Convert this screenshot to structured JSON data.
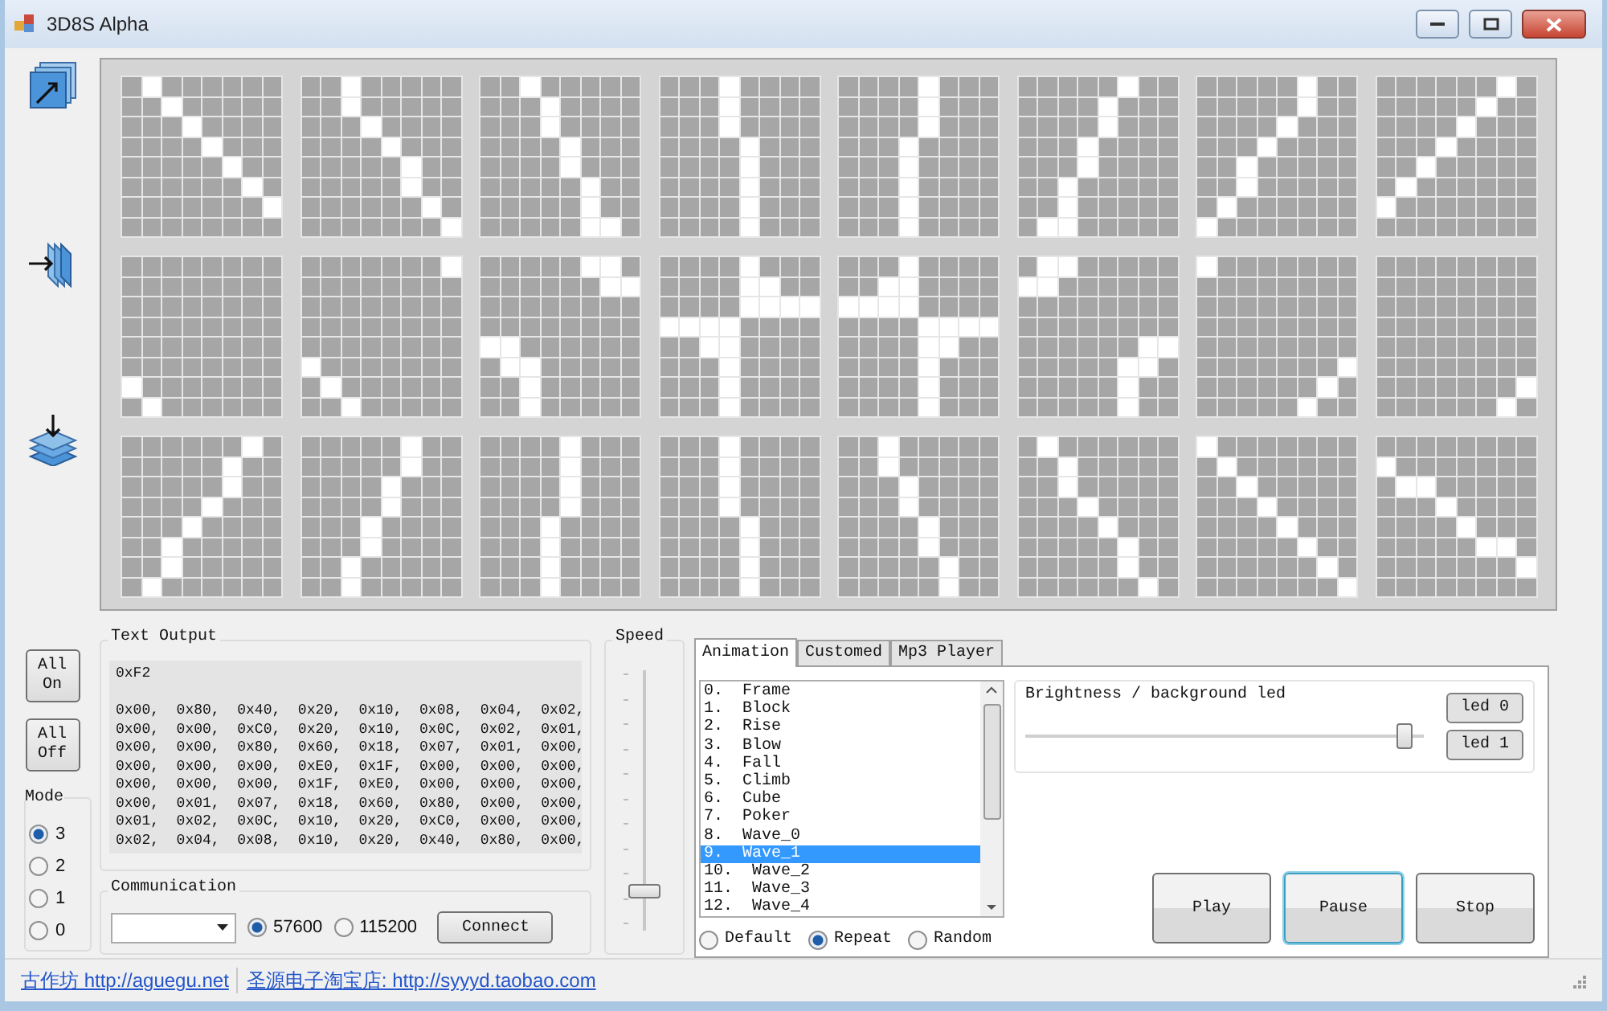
{
  "window": {
    "title": "3D8S Alpha"
  },
  "frames": [
    {
      "rows": [
        [
          false,
          true,
          false,
          false,
          false,
          false,
          false,
          false
        ],
        [
          false,
          false,
          true,
          false,
          false,
          false,
          false,
          false
        ],
        [
          false,
          false,
          false,
          true,
          false,
          false,
          false,
          false
        ],
        [
          false,
          false,
          false,
          false,
          true,
          false,
          false,
          false
        ],
        [
          false,
          false,
          false,
          false,
          false,
          true,
          false,
          false
        ],
        [
          false,
          false,
          false,
          false,
          false,
          false,
          true,
          false
        ],
        [
          false,
          false,
          false,
          false,
          false,
          false,
          false,
          true
        ],
        [
          false,
          false,
          false,
          false,
          false,
          false,
          false,
          false
        ]
      ]
    },
    {
      "rows": [
        [
          false,
          false,
          true,
          false,
          false,
          false,
          false,
          false
        ],
        [
          false,
          false,
          true,
          false,
          false,
          false,
          false,
          false
        ],
        [
          false,
          false,
          false,
          true,
          false,
          false,
          false,
          false
        ],
        [
          false,
          false,
          false,
          false,
          true,
          false,
          false,
          false
        ],
        [
          false,
          false,
          false,
          false,
          false,
          true,
          false,
          false
        ],
        [
          false,
          false,
          false,
          false,
          false,
          true,
          false,
          false
        ],
        [
          false,
          false,
          false,
          false,
          false,
          false,
          true,
          false
        ],
        [
          false,
          false,
          false,
          false,
          false,
          false,
          false,
          true
        ]
      ]
    },
    {
      "rows": [
        [
          false,
          false,
          true,
          false,
          false,
          false,
          false,
          false
        ],
        [
          false,
          false,
          false,
          true,
          false,
          false,
          false,
          false
        ],
        [
          false,
          false,
          false,
          true,
          false,
          false,
          false,
          false
        ],
        [
          false,
          false,
          false,
          false,
          true,
          false,
          false,
          false
        ],
        [
          false,
          false,
          false,
          false,
          true,
          false,
          false,
          false
        ],
        [
          false,
          false,
          false,
          false,
          false,
          true,
          false,
          false
        ],
        [
          false,
          false,
          false,
          false,
          false,
          true,
          false,
          false
        ],
        [
          false,
          false,
          false,
          false,
          false,
          true,
          true,
          false
        ]
      ]
    },
    {
      "rows": [
        [
          false,
          false,
          false,
          true,
          false,
          false,
          false,
          false
        ],
        [
          false,
          false,
          false,
          true,
          false,
          false,
          false,
          false
        ],
        [
          false,
          false,
          false,
          true,
          false,
          false,
          false,
          false
        ],
        [
          false,
          false,
          false,
          false,
          true,
          false,
          false,
          false
        ],
        [
          false,
          false,
          false,
          false,
          true,
          false,
          false,
          false
        ],
        [
          false,
          false,
          false,
          false,
          true,
          false,
          false,
          false
        ],
        [
          false,
          false,
          false,
          false,
          true,
          false,
          false,
          false
        ],
        [
          false,
          false,
          false,
          false,
          true,
          false,
          false,
          false
        ]
      ]
    },
    {
      "rows": [
        [
          false,
          false,
          false,
          false,
          true,
          false,
          false,
          false
        ],
        [
          false,
          false,
          false,
          false,
          true,
          false,
          false,
          false
        ],
        [
          false,
          false,
          false,
          false,
          true,
          false,
          false,
          false
        ],
        [
          false,
          false,
          false,
          true,
          false,
          false,
          false,
          false
        ],
        [
          false,
          false,
          false,
          true,
          false,
          false,
          false,
          false
        ],
        [
          false,
          false,
          false,
          true,
          false,
          false,
          false,
          false
        ],
        [
          false,
          false,
          false,
          true,
          false,
          false,
          false,
          false
        ],
        [
          false,
          false,
          false,
          true,
          false,
          false,
          false,
          false
        ]
      ]
    },
    {
      "rows": [
        [
          false,
          false,
          false,
          false,
          false,
          true,
          false,
          false
        ],
        [
          false,
          false,
          false,
          false,
          true,
          false,
          false,
          false
        ],
        [
          false,
          false,
          false,
          false,
          true,
          false,
          false,
          false
        ],
        [
          false,
          false,
          false,
          true,
          false,
          false,
          false,
          false
        ],
        [
          false,
          false,
          false,
          true,
          false,
          false,
          false,
          false
        ],
        [
          false,
          false,
          true,
          false,
          false,
          false,
          false,
          false
        ],
        [
          false,
          false,
          true,
          false,
          false,
          false,
          false,
          false
        ],
        [
          false,
          true,
          true,
          false,
          false,
          false,
          false,
          false
        ]
      ]
    },
    {
      "rows": [
        [
          false,
          false,
          false,
          false,
          false,
          true,
          false,
          false
        ],
        [
          false,
          false,
          false,
          false,
          false,
          true,
          false,
          false
        ],
        [
          false,
          false,
          false,
          false,
          true,
          false,
          false,
          false
        ],
        [
          false,
          false,
          false,
          true,
          false,
          false,
          false,
          false
        ],
        [
          false,
          false,
          true,
          false,
          false,
          false,
          false,
          false
        ],
        [
          false,
          false,
          true,
          false,
          false,
          false,
          false,
          false
        ],
        [
          false,
          true,
          false,
          false,
          false,
          false,
          false,
          false
        ],
        [
          true,
          false,
          false,
          false,
          false,
          false,
          false,
          false
        ]
      ]
    },
    {
      "rows": [
        [
          false,
          false,
          false,
          false,
          false,
          false,
          true,
          false
        ],
        [
          false,
          false,
          false,
          false,
          false,
          true,
          false,
          false
        ],
        [
          false,
          false,
          false,
          false,
          true,
          false,
          false,
          false
        ],
        [
          false,
          false,
          false,
          true,
          false,
          false,
          false,
          false
        ],
        [
          false,
          false,
          true,
          false,
          false,
          false,
          false,
          false
        ],
        [
          false,
          true,
          false,
          false,
          false,
          false,
          false,
          false
        ],
        [
          true,
          false,
          false,
          false,
          false,
          false,
          false,
          false
        ],
        [
          false,
          false,
          false,
          false,
          false,
          false,
          false,
          false
        ]
      ]
    },
    {
      "rows": [
        [
          false,
          false,
          false,
          false,
          false,
          false,
          false,
          false
        ],
        [
          false,
          false,
          false,
          false,
          false,
          false,
          false,
          false
        ],
        [
          false,
          false,
          false,
          false,
          false,
          false,
          false,
          false
        ],
        [
          false,
          false,
          false,
          false,
          false,
          false,
          false,
          false
        ],
        [
          false,
          false,
          false,
          false,
          false,
          false,
          false,
          false
        ],
        [
          false,
          false,
          false,
          false,
          false,
          false,
          false,
          false
        ],
        [
          true,
          false,
          false,
          false,
          false,
          false,
          false,
          false
        ],
        [
          false,
          true,
          false,
          false,
          false,
          false,
          false,
          false
        ]
      ]
    },
    {
      "rows": [
        [
          false,
          false,
          false,
          false,
          false,
          false,
          false,
          true
        ],
        [
          false,
          false,
          false,
          false,
          false,
          false,
          false,
          false
        ],
        [
          false,
          false,
          false,
          false,
          false,
          false,
          false,
          false
        ],
        [
          false,
          false,
          false,
          false,
          false,
          false,
          false,
          false
        ],
        [
          false,
          false,
          false,
          false,
          false,
          false,
          false,
          false
        ],
        [
          true,
          false,
          false,
          false,
          false,
          false,
          false,
          false
        ],
        [
          false,
          true,
          false,
          false,
          false,
          false,
          false,
          false
        ],
        [
          false,
          false,
          true,
          false,
          false,
          false,
          false,
          false
        ]
      ]
    },
    {
      "rows": [
        [
          false,
          false,
          false,
          false,
          false,
          true,
          true,
          false
        ],
        [
          false,
          false,
          false,
          false,
          false,
          false,
          true,
          true
        ],
        [
          false,
          false,
          false,
          false,
          false,
          false,
          false,
          false
        ],
        [
          false,
          false,
          false,
          false,
          false,
          false,
          false,
          false
        ],
        [
          true,
          true,
          false,
          false,
          false,
          false,
          false,
          false
        ],
        [
          false,
          true,
          true,
          false,
          false,
          false,
          false,
          false
        ],
        [
          false,
          false,
          true,
          false,
          false,
          false,
          false,
          false
        ],
        [
          false,
          false,
          true,
          false,
          false,
          false,
          false,
          false
        ]
      ]
    },
    {
      "rows": [
        [
          false,
          false,
          false,
          false,
          true,
          false,
          false,
          false
        ],
        [
          false,
          false,
          false,
          false,
          true,
          true,
          false,
          false
        ],
        [
          false,
          false,
          false,
          false,
          true,
          true,
          true,
          true
        ],
        [
          true,
          true,
          true,
          true,
          false,
          false,
          false,
          false
        ],
        [
          false,
          false,
          true,
          true,
          false,
          false,
          false,
          false
        ],
        [
          false,
          false,
          false,
          true,
          false,
          false,
          false,
          false
        ],
        [
          false,
          false,
          false,
          true,
          false,
          false,
          false,
          false
        ],
        [
          false,
          false,
          false,
          true,
          false,
          false,
          false,
          false
        ]
      ]
    },
    {
      "rows": [
        [
          false,
          false,
          false,
          true,
          false,
          false,
          false,
          false
        ],
        [
          false,
          false,
          true,
          true,
          false,
          false,
          false,
          false
        ],
        [
          true,
          true,
          true,
          true,
          false,
          false,
          false,
          false
        ],
        [
          false,
          false,
          false,
          false,
          true,
          true,
          true,
          true
        ],
        [
          false,
          false,
          false,
          false,
          true,
          true,
          false,
          false
        ],
        [
          false,
          false,
          false,
          false,
          true,
          false,
          false,
          false
        ],
        [
          false,
          false,
          false,
          false,
          true,
          false,
          false,
          false
        ],
        [
          false,
          false,
          false,
          false,
          true,
          false,
          false,
          false
        ]
      ]
    },
    {
      "rows": [
        [
          false,
          true,
          true,
          false,
          false,
          false,
          false,
          false
        ],
        [
          true,
          true,
          false,
          false,
          false,
          false,
          false,
          false
        ],
        [
          false,
          false,
          false,
          false,
          false,
          false,
          false,
          false
        ],
        [
          false,
          false,
          false,
          false,
          false,
          false,
          false,
          false
        ],
        [
          false,
          false,
          false,
          false,
          false,
          false,
          true,
          true
        ],
        [
          false,
          false,
          false,
          false,
          false,
          true,
          true,
          false
        ],
        [
          false,
          false,
          false,
          false,
          false,
          true,
          false,
          false
        ],
        [
          false,
          false,
          false,
          false,
          false,
          true,
          false,
          false
        ]
      ]
    },
    {
      "rows": [
        [
          true,
          false,
          false,
          false,
          false,
          false,
          false,
          false
        ],
        [
          false,
          false,
          false,
          false,
          false,
          false,
          false,
          false
        ],
        [
          false,
          false,
          false,
          false,
          false,
          false,
          false,
          false
        ],
        [
          false,
          false,
          false,
          false,
          false,
          false,
          false,
          false
        ],
        [
          false,
          false,
          false,
          false,
          false,
          false,
          false,
          false
        ],
        [
          false,
          false,
          false,
          false,
          false,
          false,
          false,
          true
        ],
        [
          false,
          false,
          false,
          false,
          false,
          false,
          true,
          false
        ],
        [
          false,
          false,
          false,
          false,
          false,
          true,
          false,
          false
        ]
      ]
    },
    {
      "rows": [
        [
          false,
          false,
          false,
          false,
          false,
          false,
          false,
          false
        ],
        [
          false,
          false,
          false,
          false,
          false,
          false,
          false,
          false
        ],
        [
          false,
          false,
          false,
          false,
          false,
          false,
          false,
          false
        ],
        [
          false,
          false,
          false,
          false,
          false,
          false,
          false,
          false
        ],
        [
          false,
          false,
          false,
          false,
          false,
          false,
          false,
          false
        ],
        [
          false,
          false,
          false,
          false,
          false,
          false,
          false,
          false
        ],
        [
          false,
          false,
          false,
          false,
          false,
          false,
          false,
          true
        ],
        [
          false,
          false,
          false,
          false,
          false,
          false,
          true,
          false
        ]
      ]
    },
    {
      "rows": [
        [
          false,
          false,
          false,
          false,
          false,
          false,
          true,
          false
        ],
        [
          false,
          false,
          false,
          false,
          false,
          true,
          false,
          false
        ],
        [
          false,
          false,
          false,
          false,
          false,
          true,
          false,
          false
        ],
        [
          false,
          false,
          false,
          false,
          true,
          false,
          false,
          false
        ],
        [
          false,
          false,
          false,
          true,
          false,
          false,
          false,
          false
        ],
        [
          false,
          false,
          true,
          false,
          false,
          false,
          false,
          false
        ],
        [
          false,
          false,
          true,
          false,
          false,
          false,
          false,
          false
        ],
        [
          false,
          true,
          false,
          false,
          false,
          false,
          false,
          false
        ]
      ]
    },
    {
      "rows": [
        [
          false,
          false,
          false,
          false,
          false,
          true,
          false,
          false
        ],
        [
          false,
          false,
          false,
          false,
          false,
          true,
          false,
          false
        ],
        [
          false,
          false,
          false,
          false,
          true,
          false,
          false,
          false
        ],
        [
          false,
          false,
          false,
          false,
          true,
          false,
          false,
          false
        ],
        [
          false,
          false,
          false,
          true,
          false,
          false,
          false,
          false
        ],
        [
          false,
          false,
          false,
          true,
          false,
          false,
          false,
          false
        ],
        [
          false,
          false,
          true,
          false,
          false,
          false,
          false,
          false
        ],
        [
          false,
          false,
          true,
          false,
          false,
          false,
          false,
          false
        ]
      ]
    },
    {
      "rows": [
        [
          false,
          false,
          false,
          false,
          true,
          false,
          false,
          false
        ],
        [
          false,
          false,
          false,
          false,
          true,
          false,
          false,
          false
        ],
        [
          false,
          false,
          false,
          false,
          true,
          false,
          false,
          false
        ],
        [
          false,
          false,
          false,
          false,
          true,
          false,
          false,
          false
        ],
        [
          false,
          false,
          false,
          true,
          false,
          false,
          false,
          false
        ],
        [
          false,
          false,
          false,
          true,
          false,
          false,
          false,
          false
        ],
        [
          false,
          false,
          false,
          true,
          false,
          false,
          false,
          false
        ],
        [
          false,
          false,
          false,
          true,
          false,
          false,
          false,
          false
        ]
      ]
    },
    {
      "rows": [
        [
          false,
          false,
          false,
          true,
          false,
          false,
          false,
          false
        ],
        [
          false,
          false,
          false,
          true,
          false,
          false,
          false,
          false
        ],
        [
          false,
          false,
          false,
          true,
          false,
          false,
          false,
          false
        ],
        [
          false,
          false,
          false,
          true,
          false,
          false,
          false,
          false
        ],
        [
          false,
          false,
          false,
          false,
          true,
          false,
          false,
          false
        ],
        [
          false,
          false,
          false,
          false,
          true,
          false,
          false,
          false
        ],
        [
          false,
          false,
          false,
          false,
          true,
          false,
          false,
          false
        ],
        [
          false,
          false,
          false,
          false,
          true,
          false,
          false,
          false
        ]
      ]
    },
    {
      "rows": [
        [
          false,
          false,
          true,
          false,
          false,
          false,
          false,
          false
        ],
        [
          false,
          false,
          true,
          false,
          false,
          false,
          false,
          false
        ],
        [
          false,
          false,
          false,
          true,
          false,
          false,
          false,
          false
        ],
        [
          false,
          false,
          false,
          true,
          false,
          false,
          false,
          false
        ],
        [
          false,
          false,
          false,
          false,
          true,
          false,
          false,
          false
        ],
        [
          false,
          false,
          false,
          false,
          true,
          false,
          false,
          false
        ],
        [
          false,
          false,
          false,
          false,
          false,
          true,
          false,
          false
        ],
        [
          false,
          false,
          false,
          false,
          false,
          true,
          false,
          false
        ]
      ]
    },
    {
      "rows": [
        [
          false,
          true,
          false,
          false,
          false,
          false,
          false,
          false
        ],
        [
          false,
          false,
          true,
          false,
          false,
          false,
          false,
          false
        ],
        [
          false,
          false,
          true,
          false,
          false,
          false,
          false,
          false
        ],
        [
          false,
          false,
          false,
          true,
          false,
          false,
          false,
          false
        ],
        [
          false,
          false,
          false,
          false,
          true,
          false,
          false,
          false
        ],
        [
          false,
          false,
          false,
          false,
          false,
          true,
          false,
          false
        ],
        [
          false,
          false,
          false,
          false,
          false,
          true,
          false,
          false
        ],
        [
          false,
          false,
          false,
          false,
          false,
          false,
          true,
          false
        ]
      ]
    },
    {
      "rows": [
        [
          true,
          false,
          false,
          false,
          false,
          false,
          false,
          false
        ],
        [
          false,
          true,
          false,
          false,
          false,
          false,
          false,
          false
        ],
        [
          false,
          false,
          true,
          false,
          false,
          false,
          false,
          false
        ],
        [
          false,
          false,
          false,
          true,
          false,
          false,
          false,
          false
        ],
        [
          false,
          false,
          false,
          false,
          true,
          false,
          false,
          false
        ],
        [
          false,
          false,
          false,
          false,
          false,
          true,
          false,
          false
        ],
        [
          false,
          false,
          false,
          false,
          false,
          false,
          true,
          false
        ],
        [
          false,
          false,
          false,
          false,
          false,
          false,
          false,
          true
        ]
      ]
    },
    {
      "rows": [
        [
          false,
          false,
          false,
          false,
          false,
          false,
          false,
          false
        ],
        [
          true,
          false,
          false,
          false,
          false,
          false,
          false,
          false
        ],
        [
          false,
          true,
          true,
          false,
          false,
          false,
          false,
          false
        ],
        [
          false,
          false,
          false,
          true,
          false,
          false,
          false,
          false
        ],
        [
          false,
          false,
          false,
          false,
          true,
          false,
          false,
          false
        ],
        [
          false,
          false,
          false,
          false,
          false,
          true,
          true,
          false
        ],
        [
          false,
          false,
          false,
          false,
          false,
          false,
          false,
          true
        ],
        [
          false,
          false,
          false,
          false,
          false,
          false,
          false,
          false
        ]
      ]
    }
  ],
  "power_buttons": [
    "All On",
    "All Off"
  ],
  "mode": {
    "title": "Mode",
    "options": [
      {
        "label": "3",
        "selected": true
      },
      {
        "label": "2",
        "selected": false
      },
      {
        "label": "1",
        "selected": false
      },
      {
        "label": "0",
        "selected": false
      }
    ]
  },
  "text_output": {
    "title": "Text Output",
    "header": "0xF2",
    "lines": [
      "0x00,  0x80,  0x40,  0x20,  0x10,  0x08,  0x04,  0x02,",
      "0x00,  0x00,  0xC0,  0x20,  0x10,  0x0C,  0x02,  0x01,",
      "0x00,  0x00,  0x80,  0x60,  0x18,  0x07,  0x01,  0x00,",
      "0x00,  0x00,  0x00,  0xE0,  0x1F,  0x00,  0x00,  0x00,",
      "0x00,  0x00,  0x00,  0x1F,  0xE0,  0x00,  0x00,  0x00,",
      "0x00,  0x01,  0x07,  0x18,  0x60,  0x80,  0x00,  0x00,",
      "0x01,  0x02,  0x0C,  0x10,  0x20,  0xC0,  0x00,  0x00,",
      "0x02,  0x04,  0x08,  0x10,  0x20,  0x40,  0x80,  0x00,"
    ]
  },
  "communication": {
    "title": "Communication",
    "baud_rates": [
      {
        "label": "57600",
        "selected": true
      },
      {
        "label": "115200",
        "selected": false
      }
    ],
    "connect": "Connect"
  },
  "speed": {
    "title": "Speed",
    "level": 0.12
  },
  "tabs": [
    {
      "label": "Animation",
      "selected": true
    },
    {
      "label": "Customed",
      "selected": false
    },
    {
      "label": "Mp3 Player",
      "selected": false
    }
  ],
  "animations": [
    {
      "label": "0.  Frame",
      "selected": false
    },
    {
      "label": "1.  Block",
      "selected": false
    },
    {
      "label": "2.  Rise",
      "selected": false
    },
    {
      "label": "3.  Blow",
      "selected": false
    },
    {
      "label": "4.  Fall",
      "selected": false
    },
    {
      "label": "5.  Climb",
      "selected": false
    },
    {
      "label": "6.  Cube",
      "selected": false
    },
    {
      "label": "7.  Poker",
      "selected": false
    },
    {
      "label": "8.  Wave_0",
      "selected": false
    },
    {
      "label": "9.  Wave_1",
      "selected": true
    },
    {
      "label": "10.  Wave_2",
      "selected": false
    },
    {
      "label": "11.  Wave_3",
      "selected": false
    },
    {
      "label": "12.  Wave_4",
      "selected": false
    }
  ],
  "play_modes": [
    {
      "label": "Default",
      "selected": false
    },
    {
      "label": "Repeat",
      "selected": true
    },
    {
      "label": "Random",
      "selected": false
    }
  ],
  "brightness": {
    "title": "Brightness / background led",
    "level": 0.97
  },
  "led_buttons": [
    "led 0",
    "led 1"
  ],
  "controls": [
    {
      "label": "Play",
      "focused": false
    },
    {
      "label": "Pause",
      "focused": true
    },
    {
      "label": "Stop",
      "focused": false
    }
  ],
  "status_bar": {
    "links": [
      "古作坊 http://aguegu.net",
      "圣源电子淘宝店: http://syyyd.taobao.com"
    ]
  }
}
